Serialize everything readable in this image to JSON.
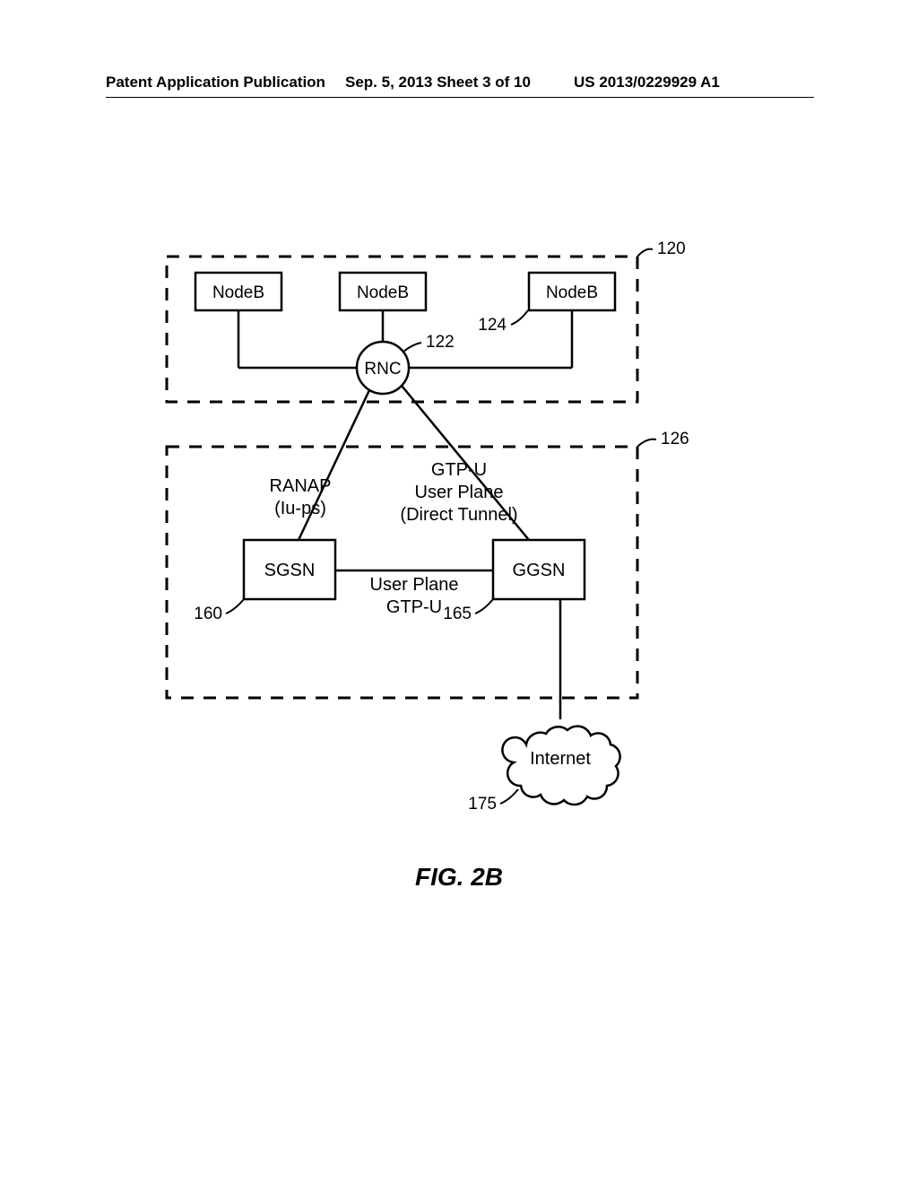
{
  "header": {
    "left": "Patent Application Publication",
    "center": "Sep. 5, 2013  Sheet 3 of 10",
    "right": "US 2013/0229929 A1"
  },
  "diagram": {
    "nodeb1": "NodeB",
    "nodeb2": "NodeB",
    "nodeb3": "NodeB",
    "rnc": "RNC",
    "sgsn": "SGSN",
    "ggsn": "GGSN",
    "internet": "Internet",
    "ranap_line1": "RANAP",
    "ranap_line2": "(Iu-ps)",
    "gtpu_line1": "GTP-U",
    "gtpu_line2": "User Plane",
    "gtpu_line3": "(Direct Tunnel)",
    "midlabel_line1": "User Plane",
    "midlabel_line2": "GTP-U",
    "ref120": "120",
    "ref122": "122",
    "ref124": "124",
    "ref126": "126",
    "ref160": "160",
    "ref165": "165",
    "ref175": "175"
  },
  "fig_caption": "FIG. 2B"
}
